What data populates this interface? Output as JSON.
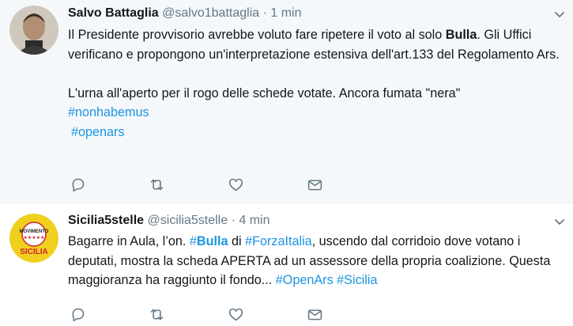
{
  "tweets": [
    {
      "name": "Salvo Battaglia",
      "handle": "@salvo1battaglia",
      "separator": "·",
      "time": "1 min",
      "lines": [
        "Il Presidente provvisorio avrebbe voluto fare ripetere il voto al solo ",
        "Bulla",
        ". Gli Uffici verificano e propongono un'interpretazione estensiva dell'art.133 del Regolamento Ars."
      ],
      "paragraph2": "L'urna all'aperto per il rogo delle schede votate. Ancora fumata \"nera\"",
      "hashtags": [
        "#nonhabemus",
        "#openars"
      ],
      "avatar_icon": "profile-photo"
    },
    {
      "name": "Sicilia5stelle",
      "handle": "@sicilia5stelle",
      "separator": "·",
      "time": "4 min",
      "segments": [
        {
          "text": "Bagarre in Aula, l’on. ",
          "style": "plain"
        },
        {
          "text": "#",
          "style": "hashtag"
        },
        {
          "text": "Bulla",
          "style": "hashtag-bold"
        },
        {
          "text": " di ",
          "style": "plain"
        },
        {
          "text": "#ForzaItalia",
          "style": "hashtag"
        },
        {
          "text": ", uscendo dal corridoio dove votano i deputati, mostra la scheda APERTA ad un assessore della propria coalizione. Questa maggioranza ha raggiunto il fondo... ",
          "style": "plain"
        },
        {
          "text": "#OpenArs",
          "style": "hashtag"
        },
        {
          "text": " ",
          "style": "plain"
        },
        {
          "text": "#Sicilia",
          "style": "hashtag"
        }
      ],
      "avatar_logo": {
        "top": "MOVIMENTO",
        "bottom": "SICILIA",
        "colors": {
          "ring": "#e3c51c",
          "text_red": "#d2202f"
        }
      }
    }
  ],
  "actions": [
    "reply-icon",
    "retweet-icon",
    "like-icon",
    "message-icon"
  ],
  "colors": {
    "link": "#1b95e0",
    "meta": "#657786",
    "icon": "#657786",
    "first_bg": "#f5f8fa"
  }
}
